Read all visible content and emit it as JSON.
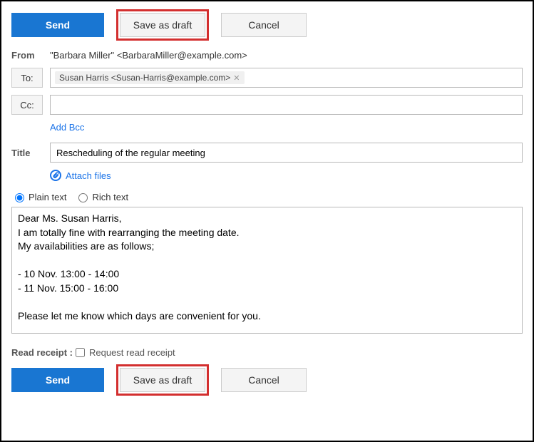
{
  "buttons": {
    "send": "Send",
    "save_draft": "Save as draft",
    "cancel": "Cancel"
  },
  "labels": {
    "from": "From",
    "to": "To:",
    "cc": "Cc:",
    "title": "Title",
    "add_bcc": "Add Bcc",
    "attach": "Attach files",
    "plain_text": "Plain text",
    "rich_text": "Rich text",
    "read_receipt_label": "Read receipt :",
    "request_read_receipt": "Request read receipt"
  },
  "from_value": "\"Barbara Miller\" <BarbaraMiller@example.com>",
  "to_chip": "Susan Harris <Susan-Harris@example.com>",
  "cc_value": "",
  "title_value": "Rescheduling of the regular meeting",
  "body": "Dear Ms. Susan Harris,\nI am totally fine with rearranging the meeting date.\nMy availabilities are as follows;\n\n- 10 Nov. 13:00 - 14:00\n- 11 Nov. 15:00 - 16:00\n\nPlease let me know which days are convenient for you.",
  "format_selected": "plain",
  "read_receipt_checked": false
}
